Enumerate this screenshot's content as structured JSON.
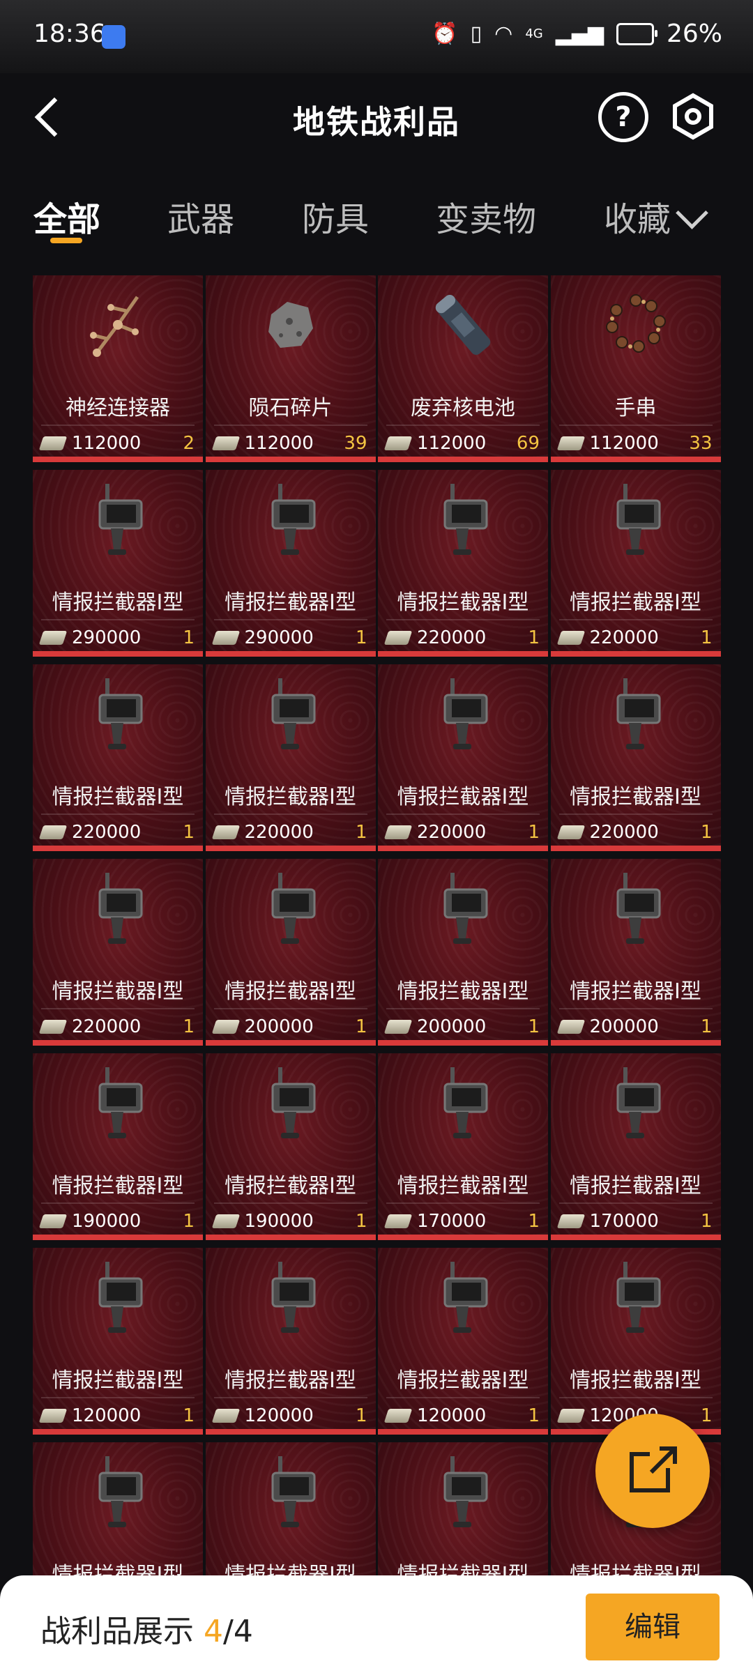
{
  "status_bar": {
    "time": "18:36",
    "network": "4G",
    "battery": "26%"
  },
  "header": {
    "title": "地铁战利品"
  },
  "tabs": [
    {
      "label": "全部",
      "active": true
    },
    {
      "label": "武器",
      "active": false
    },
    {
      "label": "防具",
      "active": false
    },
    {
      "label": "变卖物",
      "active": false
    },
    {
      "label": "收藏",
      "active": false
    }
  ],
  "items": [
    {
      "name": "神经连接器",
      "price": "112000",
      "count": "2",
      "icon": "neural-connector-icon"
    },
    {
      "name": "陨石碎片",
      "price": "112000",
      "count": "39",
      "icon": "meteorite-fragment-icon"
    },
    {
      "name": "废弃核电池",
      "price": "112000",
      "count": "69",
      "icon": "nuclear-battery-icon"
    },
    {
      "name": "手串",
      "price": "112000",
      "count": "33",
      "icon": "bead-bracelet-icon"
    },
    {
      "name": "情报拦截器I型",
      "price": "290000",
      "count": "1",
      "icon": "intel-interceptor-icon"
    },
    {
      "name": "情报拦截器I型",
      "price": "290000",
      "count": "1",
      "icon": "intel-interceptor-icon"
    },
    {
      "name": "情报拦截器I型",
      "price": "220000",
      "count": "1",
      "icon": "intel-interceptor-icon"
    },
    {
      "name": "情报拦截器I型",
      "price": "220000",
      "count": "1",
      "icon": "intel-interceptor-icon"
    },
    {
      "name": "情报拦截器I型",
      "price": "220000",
      "count": "1",
      "icon": "intel-interceptor-icon"
    },
    {
      "name": "情报拦截器I型",
      "price": "220000",
      "count": "1",
      "icon": "intel-interceptor-icon"
    },
    {
      "name": "情报拦截器I型",
      "price": "220000",
      "count": "1",
      "icon": "intel-interceptor-icon"
    },
    {
      "name": "情报拦截器I型",
      "price": "220000",
      "count": "1",
      "icon": "intel-interceptor-icon"
    },
    {
      "name": "情报拦截器I型",
      "price": "220000",
      "count": "1",
      "icon": "intel-interceptor-icon"
    },
    {
      "name": "情报拦截器I型",
      "price": "200000",
      "count": "1",
      "icon": "intel-interceptor-icon"
    },
    {
      "name": "情报拦截器I型",
      "price": "200000",
      "count": "1",
      "icon": "intel-interceptor-icon"
    },
    {
      "name": "情报拦截器I型",
      "price": "200000",
      "count": "1",
      "icon": "intel-interceptor-icon"
    },
    {
      "name": "情报拦截器I型",
      "price": "190000",
      "count": "1",
      "icon": "intel-interceptor-icon"
    },
    {
      "name": "情报拦截器I型",
      "price": "190000",
      "count": "1",
      "icon": "intel-interceptor-icon"
    },
    {
      "name": "情报拦截器I型",
      "price": "170000",
      "count": "1",
      "icon": "intel-interceptor-icon"
    },
    {
      "name": "情报拦截器I型",
      "price": "170000",
      "count": "1",
      "icon": "intel-interceptor-icon"
    },
    {
      "name": "情报拦截器I型",
      "price": "120000",
      "count": "1",
      "icon": "intel-interceptor-icon"
    },
    {
      "name": "情报拦截器I型",
      "price": "120000",
      "count": "1",
      "icon": "intel-interceptor-icon"
    },
    {
      "name": "情报拦截器I型",
      "price": "120000",
      "count": "1",
      "icon": "intel-interceptor-icon"
    },
    {
      "name": "情报拦截器I型",
      "price": "120000",
      "count": "1",
      "icon": "intel-interceptor-icon"
    },
    {
      "name": "情报拦截器I型",
      "price": "",
      "count": "",
      "icon": "intel-interceptor-icon"
    },
    {
      "name": "情报拦截器I型",
      "price": "",
      "count": "",
      "icon": "intel-interceptor-icon"
    },
    {
      "name": "情报拦截器I型",
      "price": "",
      "count": "",
      "icon": "intel-interceptor-icon"
    },
    {
      "name": "情报拦截器I型",
      "price": "",
      "count": "",
      "icon": "intel-interceptor-icon"
    }
  ],
  "bottom_bar": {
    "label": "战利品展示",
    "current": "4",
    "separator": "/",
    "total": "4",
    "edit_label": "编辑"
  },
  "colors": {
    "accent": "#f5a623",
    "card_bar": "#d83a3a",
    "card_bg": "#4a0f16",
    "page_bg": "#0f0f12"
  }
}
